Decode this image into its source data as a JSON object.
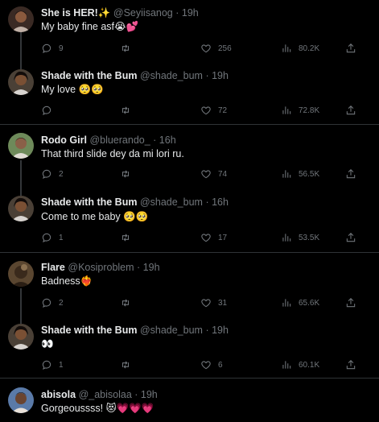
{
  "tweets": [
    {
      "name": "She is HER!✨",
      "handle": "@Seyiisanog",
      "time": "· 19h",
      "text": "My baby fine asf😭💕",
      "replies": "9",
      "retweets": "",
      "likes": "256",
      "views": "80.2K"
    },
    {
      "name": "Shade with the Bum",
      "handle": "@shade_bum",
      "time": "· 19h",
      "text": "My love 🥺🥺",
      "replies": "",
      "retweets": "",
      "likes": "72",
      "views": "72.8K"
    },
    {
      "name": "Rodo Girl",
      "handle": "@bluerando_",
      "time": "· 16h",
      "text": "That third slide dey da mi lori ru.",
      "replies": "2",
      "retweets": "",
      "likes": "74",
      "views": "56.5K"
    },
    {
      "name": "Shade with the Bum",
      "handle": "@shade_bum",
      "time": "· 16h",
      "text": "Come to me baby 🥺🥺",
      "replies": "1",
      "retweets": "",
      "likes": "17",
      "views": "53.5K"
    },
    {
      "name": "Flare",
      "handle": "@Kosiproblem",
      "time": "· 19h",
      "text": "Badness❤️‍🔥",
      "replies": "2",
      "retweets": "",
      "likes": "31",
      "views": "65.6K"
    },
    {
      "name": "Shade with the Bum",
      "handle": "@shade_bum",
      "time": "· 19h",
      "text": "👀",
      "replies": "1",
      "retweets": "",
      "likes": "6",
      "views": "60.1K"
    },
    {
      "name": "abisola",
      "handle": "@_abisolaa",
      "time": "· 19h",
      "text": "Gorgeoussss! 😻💗💗💗"
    }
  ],
  "colors": {
    "background": "#000000",
    "text": "#e7e9ea",
    "muted": "#71767b",
    "divider": "#2f3336"
  },
  "icons": [
    "reply-icon",
    "retweet-icon",
    "like-icon",
    "views-icon",
    "share-icon"
  ]
}
